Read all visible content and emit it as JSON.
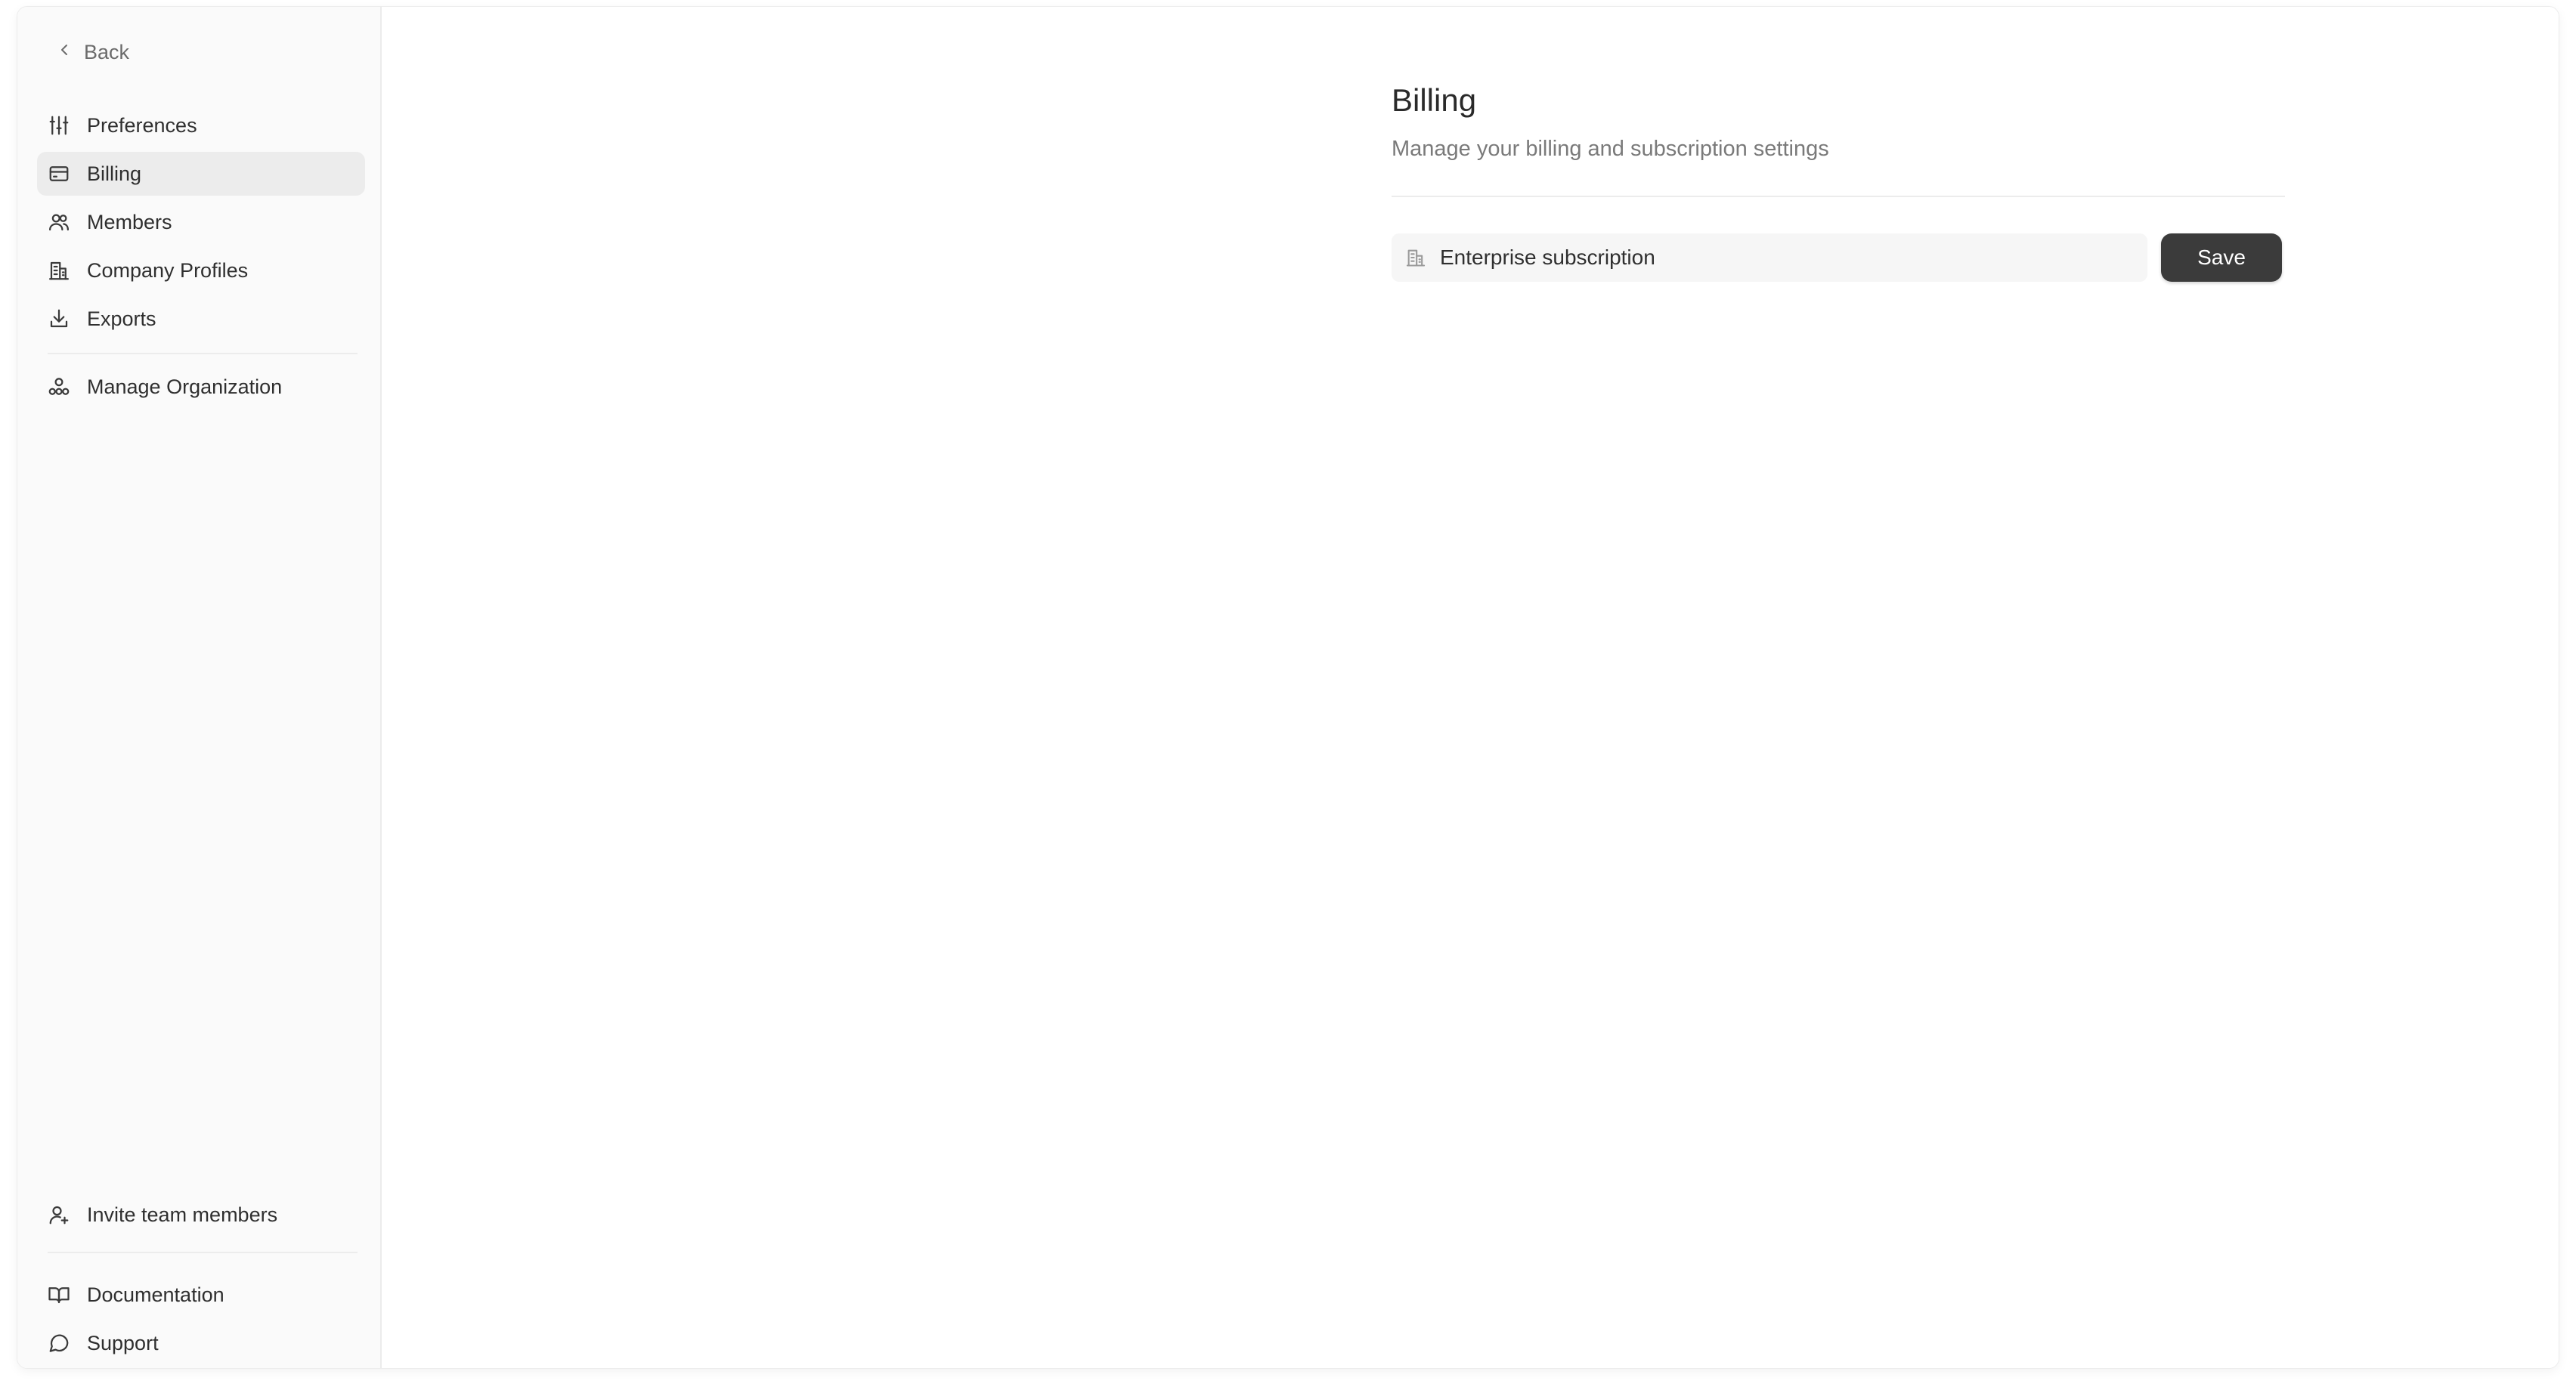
{
  "sidebar": {
    "back_label": "Back",
    "items": [
      {
        "label": "Preferences",
        "icon": "sliders-icon"
      },
      {
        "label": "Billing",
        "icon": "credit-card-icon"
      },
      {
        "label": "Members",
        "icon": "users-icon"
      },
      {
        "label": "Company Profiles",
        "icon": "building-icon"
      },
      {
        "label": "Exports",
        "icon": "download-icon"
      }
    ],
    "manage_org_label": "Manage Organization",
    "invite_label": "Invite team members",
    "documentation_label": "Documentation",
    "support_label": "Support",
    "active_item": "Billing"
  },
  "main": {
    "title": "Billing",
    "subtitle": "Manage your billing and subscription settings",
    "subscription_field": {
      "value": "Enterprise subscription",
      "icon": "building-icon"
    },
    "save_label": "Save"
  },
  "colors": {
    "active_bg": "#ececec",
    "button_bg": "#3b3b3b",
    "sidebar_bg": "#fafafa"
  }
}
